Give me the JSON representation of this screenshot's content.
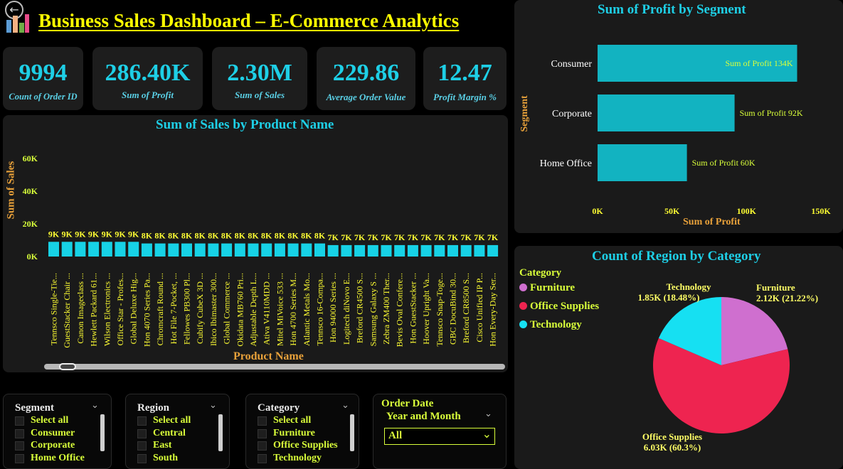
{
  "header": {
    "title": "Business Sales Dashboard – E-Commerce Analytics",
    "back_icon": "back-arrow-icon",
    "logo_icon": "bar-chart-icon"
  },
  "kpis": [
    {
      "value": "9994",
      "label": "Count of Order ID"
    },
    {
      "value": "286.40K",
      "label": "Sum of Profit"
    },
    {
      "value": "2.30M",
      "label": "Sum of Sales"
    },
    {
      "value": "229.86",
      "label": "Average Order Value"
    },
    {
      "value": "12.47",
      "label": "Profit Margin %"
    }
  ],
  "colors": {
    "accent": "#1ecfe6",
    "title": "#ffff00",
    "axis_title": "#e8a13a",
    "label_yellow": "#d9ff3a",
    "bar": "#17d2e6",
    "profit_bar": "#12b3c1",
    "furniture": "#cf6fcf",
    "office_supplies": "#ee2450",
    "technology": "#16e0f2"
  },
  "sales_chart": {
    "chart_data": {
      "type": "bar",
      "title": "Sum of Sales by Product Name",
      "xlabel": "Product Name",
      "ylabel": "Sum of Sales",
      "ylim": [
        0,
        60000
      ],
      "yticks": [
        "0K",
        "20K",
        "40K",
        "60K"
      ],
      "categories": [
        "Tennsco Single-Tie...",
        "GuestStacker Chair ...",
        "Canon Imageclass ...",
        "Hewlett Packard 61...",
        "Wilson Electronics ...",
        "Office Star - Profes...",
        "Global Deluxe Hig...",
        "Hon 4070 Series Pa...",
        "Chromcraft Round ...",
        "Hot File 7-Pocket, ...",
        "Fellowes PB300 Pl...",
        "Cubify CubeX 3D ...",
        "Ibico Ibimaster 300...",
        "Global Commerce ...",
        "Okidata MB760 Pri...",
        "Adjustable Depth L...",
        "Ativa V4110MDD ...",
        "Mitel MiVoice 533 ...",
        "Hon 4700 Series M...",
        "Atlantic Metals Mo...",
        "Tennsco 16-Compa...",
        "Hon 94000 Series ...",
        "Logitech diNovo E...",
        "Breford CR4500 S...",
        "Samsung Galaxy S ...",
        "Zebra ZM400 Ther...",
        "Bevis Oval Confere...",
        "Hon GuestStacker ...",
        "Hoover Upright Va...",
        "Tennsco Snap-Toge...",
        "GBC DocuBind 30...",
        "Breford CR8500 S...",
        "Cisco Unified IP P...",
        "Hon Every-Day Ser..."
      ],
      "values": [
        9000,
        9000,
        9000,
        9000,
        9000,
        9000,
        9000,
        8000,
        8000,
        8000,
        8000,
        8000,
        8000,
        8000,
        8000,
        8000,
        8000,
        8000,
        8000,
        8000,
        8000,
        7000,
        7000,
        7000,
        7000,
        7000,
        7000,
        7000,
        7000,
        7000,
        7000,
        7000,
        7000,
        7000
      ],
      "data_labels": [
        "9K",
        "9K",
        "9K",
        "9K",
        "9K",
        "9K",
        "9K",
        "8K",
        "8K",
        "8K",
        "8K",
        "8K",
        "8K",
        "8K",
        "8K",
        "8K",
        "8K",
        "8K",
        "8K",
        "8K",
        "8K",
        "7K",
        "7K",
        "7K",
        "7K",
        "7K",
        "7K",
        "7K",
        "7K",
        "7K",
        "7K",
        "7K",
        "7K",
        "7K"
      ]
    }
  },
  "profit_chart": {
    "chart_data": {
      "type": "bar",
      "orientation": "horizontal",
      "title": "Sum of Profit by Segment",
      "xlabel": "Sum of Profit",
      "ylabel": "Segment",
      "xlim": [
        0,
        150000
      ],
      "xticks": [
        "0K",
        "50K",
        "100K",
        "150K"
      ],
      "categories": [
        "Consumer",
        "Corporate",
        "Home Office"
      ],
      "values": [
        134000,
        92000,
        60000
      ],
      "data_labels": [
        "Sum of Profit 134K",
        "Sum of Profit 92K",
        "Sum of Profit 60K"
      ]
    }
  },
  "region_chart": {
    "chart_data": {
      "type": "pie",
      "title": "Count of Region by Category",
      "legend_title": "Category",
      "legend_position": "left",
      "slices": [
        {
          "name": "Furniture",
          "value": 2120,
          "label": "2.12K (21.22%)"
        },
        {
          "name": "Office Supplies",
          "value": 6030,
          "label": "6.03K (60.3%)"
        },
        {
          "name": "Technology",
          "value": 1850,
          "label": "1.85K (18.48%)"
        }
      ]
    }
  },
  "slicers": {
    "segment": {
      "title": "Segment",
      "options": [
        "Select all",
        "Consumer",
        "Corporate",
        "Home Office"
      ]
    },
    "region": {
      "title": "Region",
      "options": [
        "Select all",
        "Central",
        "East",
        "South"
      ]
    },
    "category": {
      "title": "Category",
      "options": [
        "Select all",
        "Furniture",
        "Office Supplies",
        "Technology"
      ]
    },
    "order_date": {
      "title": "Order Date",
      "subtitle": "Year and Month",
      "selected": "All"
    }
  }
}
